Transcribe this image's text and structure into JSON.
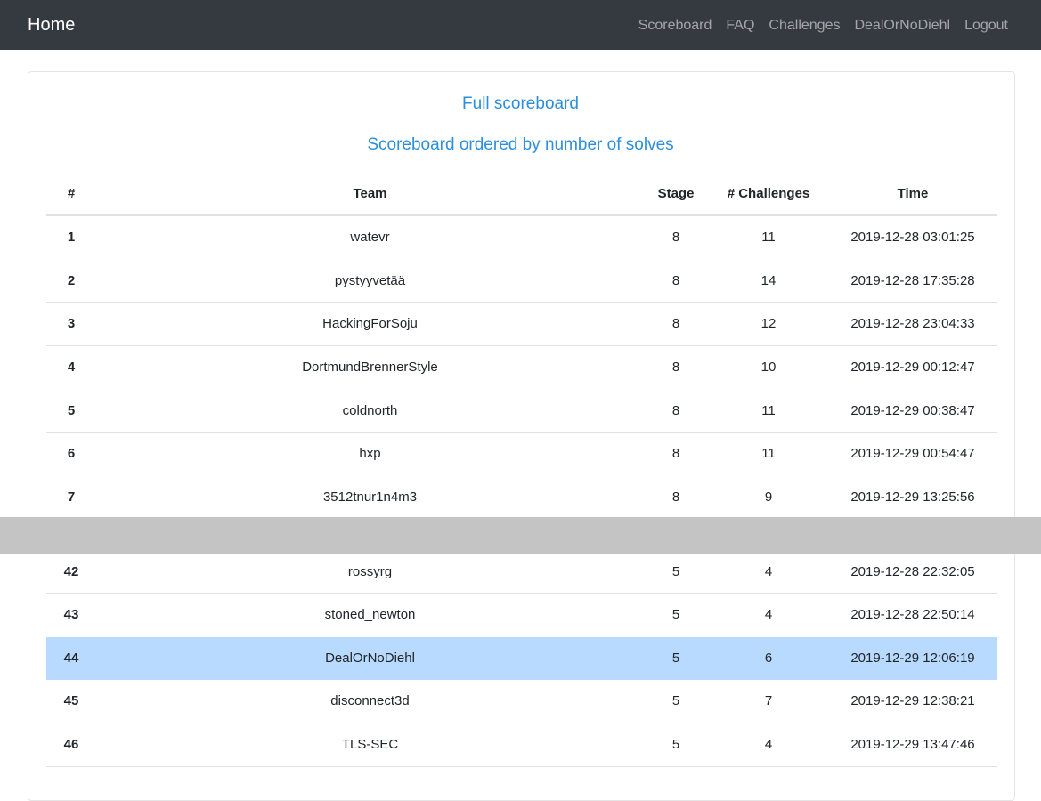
{
  "navbar": {
    "brand": "Home",
    "links": [
      "Scoreboard",
      "FAQ",
      "Challenges",
      "DealOrNoDiehl",
      "Logout"
    ]
  },
  "links": {
    "full": "Full scoreboard",
    "ordered": "Scoreboard ordered by number of solves"
  },
  "table": {
    "headers": {
      "rank": "#",
      "team": "Team",
      "stage": "Stage",
      "challenges": "# Challenges",
      "time": "Time"
    },
    "rows": [
      {
        "rank": "1",
        "team": "watevr",
        "stage": "8",
        "challenges": "11",
        "time": "2019-12-28 03:01:25"
      },
      {
        "rank": "2",
        "team": "pystyyvetää",
        "stage": "8",
        "challenges": "14",
        "time": "2019-12-28 17:35:28"
      },
      {
        "rank": "3",
        "team": "HackingForSoju",
        "stage": "8",
        "challenges": "12",
        "time": "2019-12-28 23:04:33"
      },
      {
        "rank": "4",
        "team": "DortmundBrennerStyle",
        "stage": "8",
        "challenges": "10",
        "time": "2019-12-29 00:12:47"
      },
      {
        "rank": "5",
        "team": "coldnorth",
        "stage": "8",
        "challenges": "11",
        "time": "2019-12-29 00:38:47"
      },
      {
        "rank": "6",
        "team": "hxp",
        "stage": "8",
        "challenges": "11",
        "time": "2019-12-29 00:54:47"
      },
      {
        "rank": "7",
        "team": "3512tnur1n4m3",
        "stage": "8",
        "challenges": "9",
        "time": "2019-12-29 13:25:56"
      },
      {
        "rank": "42",
        "team": "rossyrg",
        "stage": "5",
        "challenges": "4",
        "time": "2019-12-28 22:32:05"
      },
      {
        "rank": "43",
        "team": "stoned_newton",
        "stage": "5",
        "challenges": "4",
        "time": "2019-12-28 22:50:14"
      },
      {
        "rank": "44",
        "team": "DealOrNoDiehl",
        "stage": "5",
        "challenges": "6",
        "time": "2019-12-29 12:06:19"
      },
      {
        "rank": "45",
        "team": "disconnect3d",
        "stage": "5",
        "challenges": "7",
        "time": "2019-12-29 12:38:21"
      },
      {
        "rank": "46",
        "team": "TLS-SEC",
        "stage": "5",
        "challenges": "4",
        "time": "2019-12-29 13:47:46"
      }
    ]
  },
  "colors": {
    "navbar": "#343a40",
    "link": "#2d8fdb",
    "highlight": "#b8daff"
  }
}
